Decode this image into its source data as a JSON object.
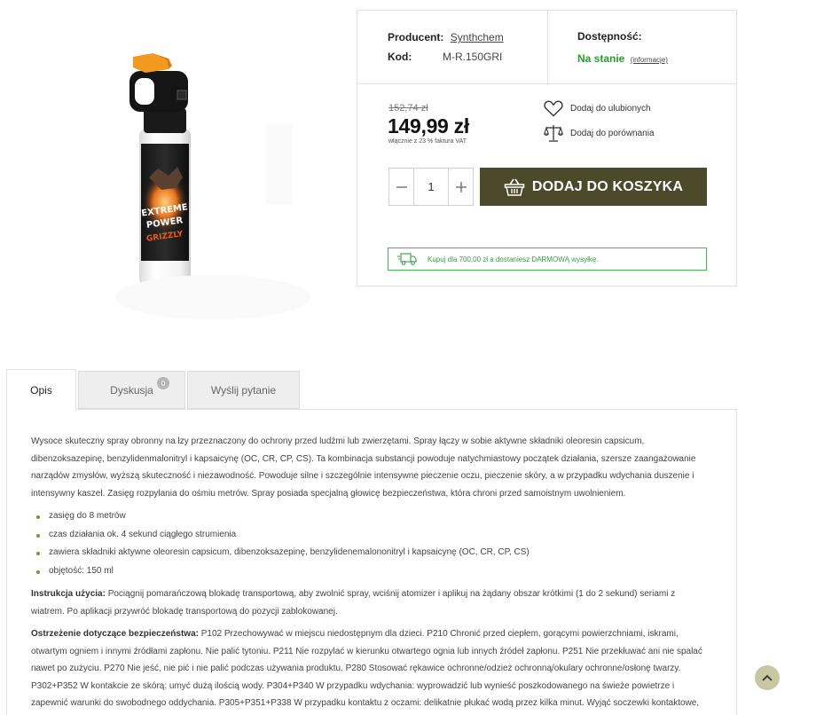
{
  "product": {
    "producer_label": "Producent:",
    "producer_name": "Synthchem",
    "code_label": "Kod:",
    "code_value": "M-R.150GRI",
    "availability_label": "Dostępność:",
    "availability_value": "Na stanie",
    "availability_info": "(informacje)",
    "old_price": "152,74 zł",
    "price": "149,99 zł",
    "vat_note": "włącznie z 23 % faktura VAT",
    "favorite_label": "Dodaj do ulubionych",
    "compare_label": "Dodaj do porównania",
    "quantity": "1",
    "add_to_cart_label": "DODAJ DO KOSZYKA",
    "free_shipping": "Kupuj dla 700,00 zł a dostaniesz DARMOWĄ wysyłkę.",
    "can_label_line1": "EXTREME",
    "can_label_line2": "POWER",
    "can_label_line3": "GRIZZLY"
  },
  "tabs": [
    {
      "label": "Opis"
    },
    {
      "label": "Dyskusja",
      "badge": "0"
    },
    {
      "label": "Wyślij pytanie"
    }
  ],
  "description": {
    "intro": "Wysoce skuteczny spray obronny na łzy przeznaczony do ochrony przed ludźmi lub zwierzętami. Spray łączy w sobie aktywne składniki oleoresin capsicum, dibenzoksazepinę, benzylidenmalonitryl i kapsaicynę (OC, CR, CP, CS). Ta kombinacja substancji powoduje natychmiastowy początek działania, szersze zaangażowanie narządów zmysłów, wyższą skuteczność i niezawodność. Powoduje silne i szczególnie intensywne pieczenie oczu, pieczenie skóry, a w przypadku wdychania duszenie i intensywny kaszel. Zasięg rozpylania do ośmiu metrów. Spray posiada specjalną głowicę bezpieczeństwa, która chroni przed samoistnym uwolnieniem.",
    "bullets": [
      "zasięg do 8 metrów",
      "czas działania ok. 4 sekund ciągłego strumienia",
      "zawiera składniki aktywne oleoresin capsicum, dibenzoksazepinę, benzylidenemalononitryl i kapsaicynę (OC, CR, CP, CS)",
      "objętość: 150 ml"
    ],
    "instruction_label": "Instrukcja użycia:",
    "instruction_text": " Pociągnij pomarańczową blokadę transportową, aby zwolnić spray, wciśnij atomizer i aplikuj na żądany obszar krótkimi (1 do 2 sekund) seriami z wiatrem. Po aplikacji przywróć blokadę transportową do pozycji zablokowanej.",
    "warning_label": "Ostrzeżenie dotyczące bezpieczeństwa:",
    "warning_text": " P102 Przechowywać w miejscu niedostępnym dla dzieci. P210 Chronić przed ciepłem, gorącymi powierzchniami, iskrami, otwartym ogniem i innymi źródłami zapłonu. Nie palić tytoniu. P211 Nie rozpylać w kierunku otwartego ognia lub innych źródeł zapłonu. P251 Nie przekłuwać ani nie spalać nawet po zużyciu. P270 Nie jeść, nie pić i nie palić podczas używania produktu. P280 Stosować rękawice ochronne/odzież ochronną/okulary ochronne/osłonę twarzy. P302+P352 W kontakcie ze skórą: umyć dużą ilością wody. P304+P340 W przypadku wdychania: wyprowadzić lub wynieść poszkodowanego na świeże powietrze i zapewnić warunki do swobodnego oddychania. P305+P351+P338 W przypadku kontaktu z oczami: delikatnie płukać wodą przez kilka minut. Wyjąć soczewki kontaktowe, jeśli są założone i jeśli"
  },
  "colors": {
    "cart_button": "#4d4a2c",
    "in_stock": "#2a9d2a",
    "shipping_border": "#3fb950",
    "scroll_top": "#c7c8a0"
  },
  "icons": {
    "favorite": "heart-icon",
    "compare": "scales-icon",
    "cart": "basket-icon",
    "shipping": "truck-icon",
    "scroll_top": "chevron-up-icon"
  }
}
